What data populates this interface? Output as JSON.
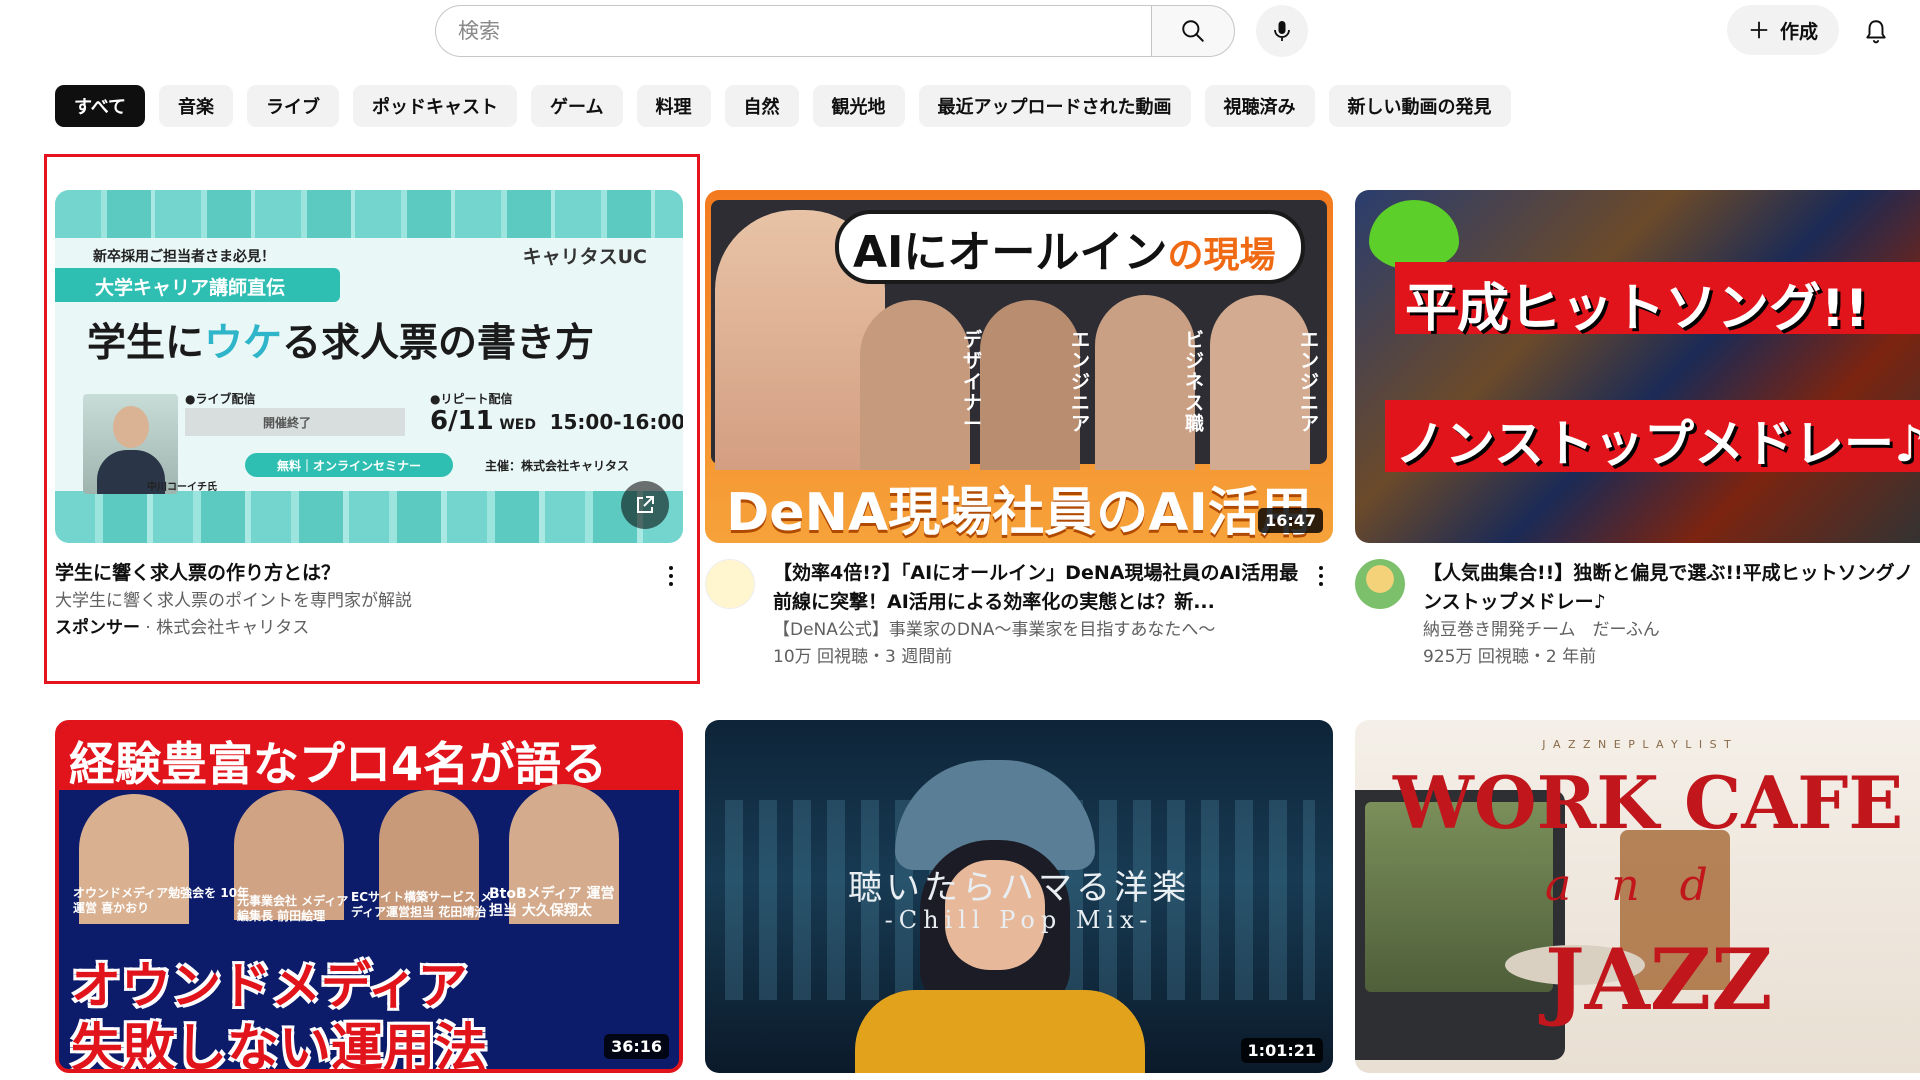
{
  "search": {
    "placeholder": "検索"
  },
  "header": {
    "create_label": "作成"
  },
  "chips": [
    "すべて",
    "音楽",
    "ライブ",
    "ポッドキャスト",
    "ゲーム",
    "料理",
    "自然",
    "観光地",
    "最近アップロードされた動画",
    "視聴済み",
    "新しい動画の発見"
  ],
  "videos": [
    {
      "title": "学生に響く求人票の作り方とは？",
      "description": "大学生に響く求人票のポイントを専門家が解説",
      "sponsor_label": "スポンサー",
      "sponsor_name": "株式会社キャリタス",
      "thumb": {
        "top_label": "新卒採用ご担当者さま必見！",
        "brand": "キャリタスUC",
        "badge": "大学キャリア講師直伝",
        "headline_a": "学生に",
        "headline_b": "ウケ",
        "headline_c": "る求人票の書き方",
        "live_label": "●ライブ配信",
        "live_status": "開催終了",
        "repeat_label": "●リピート配信",
        "date": "6/11",
        "weekday": "WED",
        "time": "15:00-16:00",
        "free_label": "無料｜オンラインセミナー",
        "host": "主催：株式会社キャリタス",
        "speaker": "中川コーイチ氏"
      }
    },
    {
      "title": "【効率4倍!?】「AIにオールイン」DeNA現場社員のAI活用最前線に突撃！AI活用による効率化の実態とは？新...",
      "channel": "【DeNA公式】事業家のDNA～事業家を目指すあなたへ～",
      "stats": "10万 回視聴・3 週間前",
      "duration": "16:47",
      "thumb": {
        "headline_a": "AIにオールイン",
        "headline_b": "の現場",
        "bottom": "DeNA現場社員のAI活用",
        "role1": "デザイナー",
        "role2": "エンジニア",
        "role3": "ビジネス職",
        "role4": "エンジニア"
      }
    },
    {
      "title": "【人気曲集合!!】独断と偏見で選ぶ!!平成ヒットソングノンストップメドレー♪",
      "channel": "納豆巻き開発チーム　だーふん",
      "stats": "925万 回視聴・2 年前",
      "thumb": {
        "line1": "平成ヒットソング!!",
        "line2": "ノンストップメドレー♪"
      }
    },
    {
      "duration": "36:16",
      "thumb": {
        "top": "経験豊富なプロ4名が語る",
        "line1": "オウンドメディア",
        "line2": "失敗しない運用法",
        "p1": "オウンドメディア勉強会を 10年運営 喜かおり",
        "p2": "元事業会社 メディア編集長 前田絵理",
        "p3": "ECサイト構築サービス メディア運営担当 花田靖治",
        "p4": "BtoBメディア 運営担当 大久保翔太"
      }
    },
    {
      "duration": "1:01:21",
      "thumb": {
        "title": "聴いたらハマる洋楽",
        "subtitle": "-Chill Pop Mix-"
      }
    },
    {
      "thumb": {
        "top": "J A Z Z N E   P L A Y L I S T",
        "work": "WORK CAFE",
        "and": "and",
        "jazz": "JAZZ"
      }
    }
  ]
}
